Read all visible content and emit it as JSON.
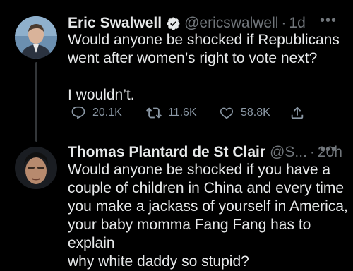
{
  "tweet1": {
    "display_name": "Eric Swalwell",
    "handle": "@ericswalwell",
    "separator": "·",
    "time": "1d",
    "text": "Would anyone be shocked if Republicans\nwent after women’s right to vote next?\n\nI wouldn’t.",
    "replies": "20.1K",
    "retweets": "11.6K",
    "likes": "58.8K",
    "verified": true
  },
  "tweet2": {
    "display_name": "Thomas Plantard de St Clair",
    "handle": "@S...",
    "separator": "·",
    "time": "20h",
    "text": "Would anyone be shocked if you have a\ncouple of children in China and every time\nyou make a jackass of yourself in America,\nyour baby momma Fang Fang has to explain\nwhy white daddy so stupid?"
  },
  "colors": {
    "background": "#000000",
    "text": "#e7e9ea",
    "muted": "#71767b",
    "verified": "#1d9bf0"
  },
  "icons": [
    "reply-icon",
    "retweet-icon",
    "like-icon",
    "share-icon",
    "verified-badge-icon",
    "more-icon"
  ]
}
